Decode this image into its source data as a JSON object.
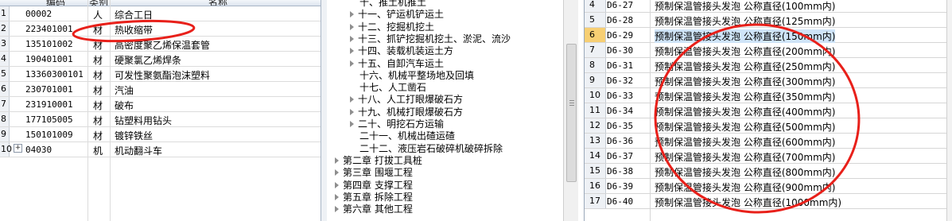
{
  "materials": {
    "headers": {
      "code": "编码",
      "type": "类别",
      "name": "名称"
    },
    "rows": [
      {
        "idx": "1",
        "code": "00002",
        "type": "人",
        "name": "综合工日",
        "expand": false
      },
      {
        "idx": "2",
        "code": "223401001",
        "type": "材",
        "name": "热收缩带",
        "expand": false
      },
      {
        "idx": "3",
        "code": "135101002",
        "type": "材",
        "name": "高密度聚乙烯保温套管",
        "expand": false
      },
      {
        "idx": "4",
        "code": "190401001",
        "type": "材",
        "name": "硬聚氯乙烯焊条",
        "expand": false
      },
      {
        "idx": "5",
        "code": "13360300101",
        "type": "材",
        "name": "可发性聚氨酯泡沫塑料",
        "expand": false
      },
      {
        "idx": "6",
        "code": "230701001",
        "type": "材",
        "name": "汽油",
        "expand": false
      },
      {
        "idx": "7",
        "code": "231910001",
        "type": "材",
        "name": "破布",
        "expand": false
      },
      {
        "idx": "8",
        "code": "177105005",
        "type": "材",
        "name": "钻塑料用钻头",
        "expand": false
      },
      {
        "idx": "9",
        "code": "150101009",
        "type": "材",
        "name": "镀锌铁丝",
        "expand": false
      },
      {
        "idx": "10",
        "code": "04030",
        "type": "机",
        "name": "机动翻斗车",
        "expand": true
      }
    ]
  },
  "tree": {
    "items": [
      {
        "label": "十、推土机推土",
        "arrow": false,
        "indent": 1
      },
      {
        "label": "十一、铲运机铲运土",
        "arrow": true,
        "indent": 1
      },
      {
        "label": "十二、挖掘机挖土",
        "arrow": true,
        "indent": 1
      },
      {
        "label": "十三、抓铲挖掘机挖土、淤泥、流沙",
        "arrow": true,
        "indent": 1
      },
      {
        "label": "十四、装载机装运土方",
        "arrow": true,
        "indent": 1
      },
      {
        "label": "十五、自卸汽车运土",
        "arrow": true,
        "indent": 1
      },
      {
        "label": "十六、机械平整场地及回填",
        "arrow": false,
        "indent": 1
      },
      {
        "label": "十七、人工凿石",
        "arrow": false,
        "indent": 1
      },
      {
        "label": "十八、人工打眼爆破石方",
        "arrow": true,
        "indent": 1
      },
      {
        "label": "十九、机械打眼爆破石方",
        "arrow": true,
        "indent": 1
      },
      {
        "label": "二十、明挖石方运输",
        "arrow": true,
        "indent": 1
      },
      {
        "label": "二十一、机械出碴运碴",
        "arrow": false,
        "indent": 1
      },
      {
        "label": "二十二、液压岩石破碎机破碎拆除",
        "arrow": false,
        "indent": 1
      },
      {
        "label": "第二章 打拔工具桩",
        "arrow": true,
        "indent": 0
      },
      {
        "label": "第三章 围堰工程",
        "arrow": true,
        "indent": 0
      },
      {
        "label": "第四章 支撑工程",
        "arrow": true,
        "indent": 0
      },
      {
        "label": "第五章 拆除工程",
        "arrow": true,
        "indent": 0
      },
      {
        "label": "第六章 其他工程",
        "arrow": true,
        "indent": 0
      }
    ]
  },
  "norms": {
    "rows": [
      {
        "num": "4",
        "code": "D6-27",
        "name": "预制保温管接头发泡 公称直径(100mm内)",
        "selected": false
      },
      {
        "num": "5",
        "code": "D6-28",
        "name": "预制保温管接头发泡 公称直径(125mm内)",
        "selected": false
      },
      {
        "num": "6",
        "code": "D6-29",
        "name": "预制保温管接头发泡 公称直径(150mm内)",
        "selected": true
      },
      {
        "num": "7",
        "code": "D6-30",
        "name": "预制保温管接头发泡 公称直径(200mm内)",
        "selected": false
      },
      {
        "num": "8",
        "code": "D6-31",
        "name": "预制保温管接头发泡 公称直径(250mm内)",
        "selected": false
      },
      {
        "num": "9",
        "code": "D6-32",
        "name": "预制保温管接头发泡 公称直径(300mm内)",
        "selected": false
      },
      {
        "num": "10",
        "code": "D6-33",
        "name": "预制保温管接头发泡 公称直径(350mm内)",
        "selected": false
      },
      {
        "num": "11",
        "code": "D6-34",
        "name": "预制保温管接头发泡 公称直径(400mm内)",
        "selected": false
      },
      {
        "num": "12",
        "code": "D6-35",
        "name": "预制保温管接头发泡 公称直径(500mm内)",
        "selected": false
      },
      {
        "num": "13",
        "code": "D6-36",
        "name": "预制保温管接头发泡 公称直径(600mm内)",
        "selected": false
      },
      {
        "num": "14",
        "code": "D6-37",
        "name": "预制保温管接头发泡 公称直径(700mm内)",
        "selected": false
      },
      {
        "num": "15",
        "code": "D6-38",
        "name": "预制保温管接头发泡 公称直径(800mm内)",
        "selected": false
      },
      {
        "num": "16",
        "code": "D6-39",
        "name": "预制保温管接头发泡 公称直径(900mm内)",
        "selected": false
      },
      {
        "num": "17",
        "code": "D6-40",
        "name": "预制保温管接头发泡 公称直径(1000mm内)",
        "selected": false
      }
    ]
  },
  "colors": {
    "annotation": "#e8201a",
    "selection": "#cfe4f8",
    "row_marker": "#f7cf73"
  }
}
